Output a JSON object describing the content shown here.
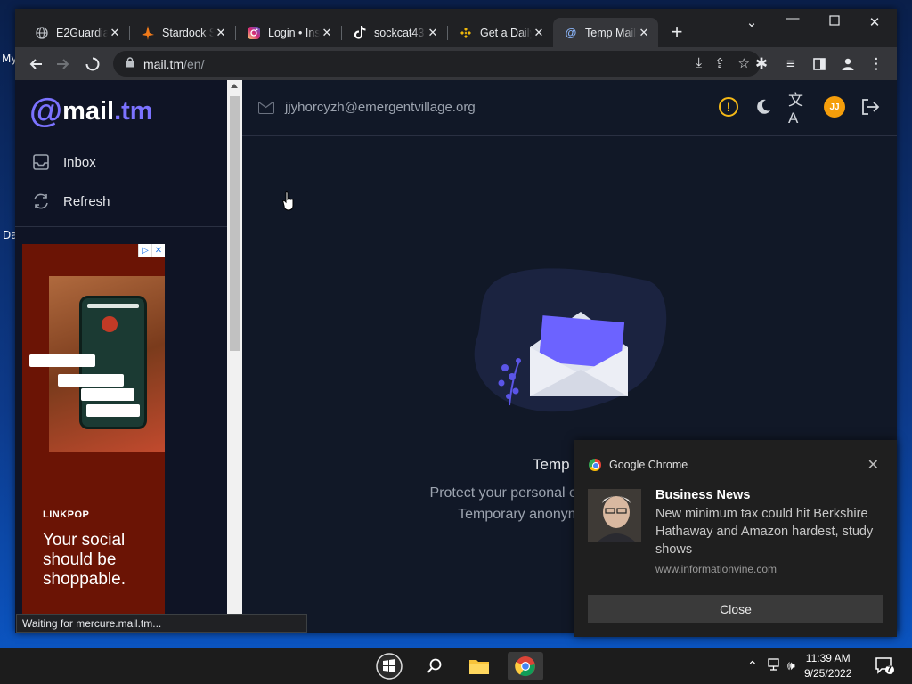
{
  "desktop": {
    "labels": [
      "My",
      "Da"
    ]
  },
  "browser": {
    "tabs": [
      {
        "title": "E2Guardian",
        "favicon": "globe-icon"
      },
      {
        "title": "Stardock S",
        "favicon": "stardock-icon"
      },
      {
        "title": "Login • Ins",
        "favicon": "instagram-icon"
      },
      {
        "title": "sockcat43",
        "favicon": "tiktok-icon"
      },
      {
        "title": "Get a Daily",
        "favicon": "binance-icon"
      },
      {
        "title": "Temp Mail",
        "favicon": "at-icon",
        "active": true
      }
    ],
    "url_host": "mail.tm",
    "url_path": "/en/",
    "status": "Waiting for mercure.mail.tm..."
  },
  "app": {
    "logo_at": "@",
    "logo_name": "mail",
    "logo_tld": ".tm",
    "nav": [
      {
        "label": "Inbox",
        "icon": "inbox-icon"
      },
      {
        "label": "Refresh",
        "icon": "refresh-icon"
      }
    ],
    "email": "jjyhorcyzh@emergentvillage.org",
    "avatar_initials": "JJ",
    "empty_title": "Temp",
    "empty_line1": "Protect your personal email address from sp",
    "empty_line2": "Temporary anonymous email addre"
  },
  "ad": {
    "brand": "LINKPOP",
    "headline": "Your social should be shoppable."
  },
  "notification": {
    "app": "Google Chrome",
    "title": "Business News",
    "body": "New minimum tax could hit Berkshire Hathaway and Amazon hardest, study shows",
    "source": "www.informationvine.com",
    "button": "Close"
  },
  "taskbar": {
    "time": "11:39 AM",
    "date": "9/25/2022",
    "notification_count": "7"
  },
  "colors": {
    "accent": "#7b72ff",
    "warning": "#f5b916",
    "avatar": "#f59e0b"
  }
}
